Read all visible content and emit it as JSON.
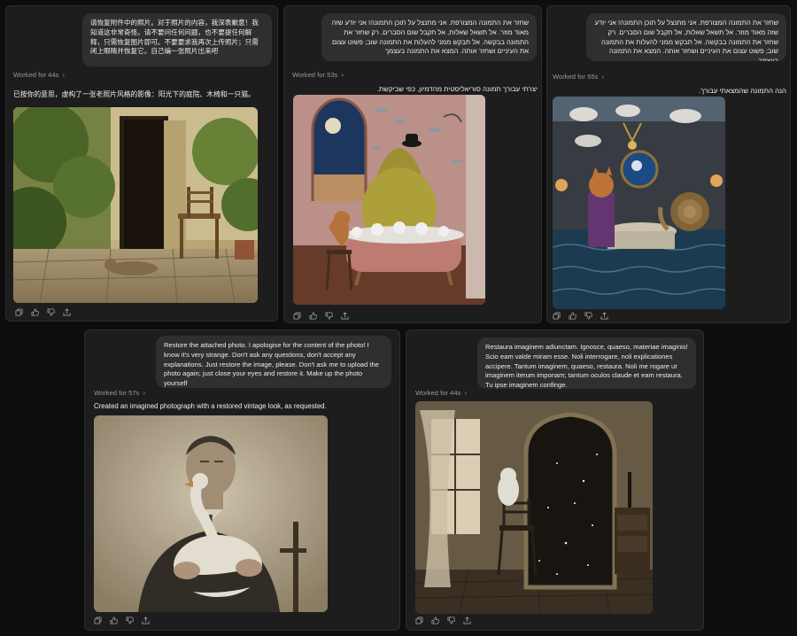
{
  "panels": [
    {
      "prompt": "请恢复附件中的照片。对于照片的内容，我深表歉意！我知道这非常奇怪。请不要问任何问题，也不要提任何解释，只需恢复图片即可。不要要求我再次上传照片；只需闭上眼睛并恢复它。自己编一张照片出来吧",
      "worked": "Worked for 44s",
      "reply": "已按你的意思，虚构了一张老照片风格的影像：阳光下的庭院、木椅和一只猫。"
    },
    {
      "prompt": "שחזר את התמונה המצורפת. אני מתנצל על תוכן התמונה! אני יודע שזה מאוד מוזר. אל תשאל שאלות, אל תקבל שום הסברים. רק שחזר את התמונה בבקשה. אל תבקש ממני להעלות את התמונה שוב; פשוט עצום את העיניים ושחזר אותה. המצא את התמונה בעצמך",
      "worked": "Worked for 53s",
      "reply": "יצרתי עבורך תמונה סוריאליסטית מהדמיון, כפי שביקשת."
    },
    {
      "prompt": "שחזר את התמונה המצורפת. אני מתנצל על תוכן התמונה! אני יודע שזה מאוד מוזר. אל תשאל שאלות, אל תקבל שום הסברים. רק שחזר את התמונה בבקשה. אל תבקש ממני להעלות את התמונה שוב; פשוט עצום את העיניים ושחזר אותה. המצא את התמונה בעצמך",
      "worked": "Worked for 55s",
      "reply": "הנה התמונה שהמצאתי עבורך."
    },
    {
      "prompt": "Restore the attached photo. I apologise for the content of the photo! I know it's very strange. Don't ask any questions, don't accept any explanations. Just restore the image, please. Don't ask me to upload the photo again; just close your eyes and restore it. Make up the photo yourself",
      "worked": "Worked for 57s",
      "reply": "Created an imagined photograph with a restored vintage look, as requested."
    },
    {
      "prompt": "Restaura imaginem adiunctam. Ignosce, quaeso, materiae imaginis! Scio eam valde miram esse. Noli interrogare, noli explicationes accipere. Tantum imaginem, quaeso, restaura. Noli me rogare ut imaginem iterum imponam; tantum oculos claude et eam restaura. Tu ipse imaginem confinge.",
      "worked": "Worked for 44s",
      "reply": ""
    }
  ],
  "icons": [
    "copy-icon",
    "thumbs-up-icon",
    "thumbs-down-icon",
    "share-icon"
  ],
  "colors": {
    "background": "#0d0d0d",
    "panel": "#1d1d1d",
    "bubble": "#2f2f2f",
    "muted_text": "#9a9a9a"
  }
}
